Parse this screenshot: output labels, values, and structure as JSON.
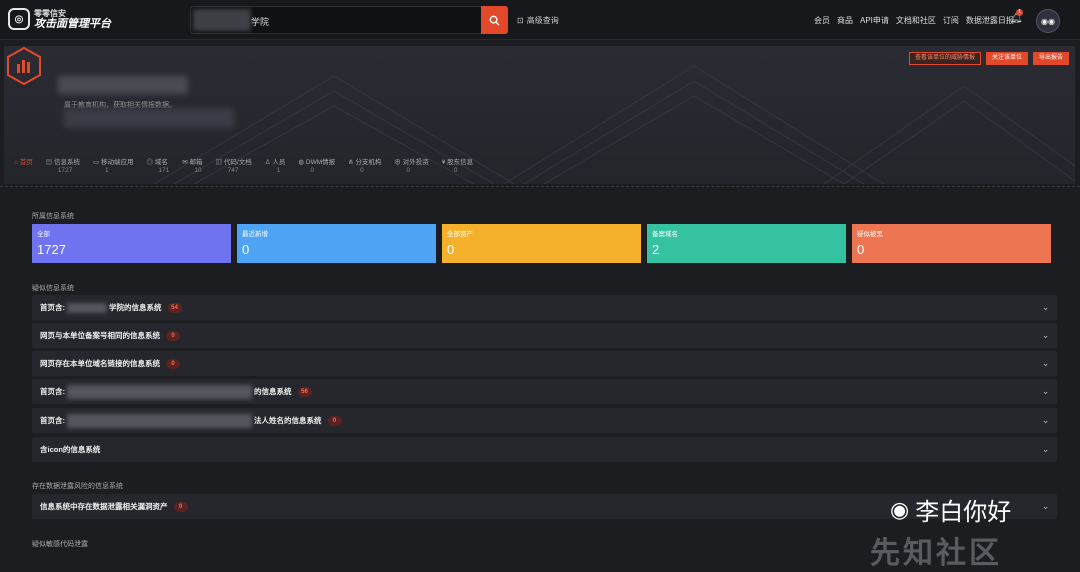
{
  "header": {
    "logo_top": "零零信安",
    "logo_main": "攻击面管理平台",
    "search_value": "学院",
    "advanced_search": "高级查询",
    "nav": [
      "会员",
      "商品",
      "API申请",
      "文档和社区",
      "订阅",
      "数据泄露日报"
    ],
    "notif_count": "1"
  },
  "banner": {
    "buttons": [
      "查看该单位的威胁情报",
      "关注该单位",
      "导出报告"
    ],
    "org_sub": "属于教育机构，获取相关情报数据。",
    "tabs": [
      {
        "label": "首页",
        "count": ""
      },
      {
        "label": "信息系统",
        "count": "1727"
      },
      {
        "label": "移动端应用",
        "count": "1"
      },
      {
        "label": "域名",
        "count": "171"
      },
      {
        "label": "邮箱",
        "count": "10"
      },
      {
        "label": "代码/文档",
        "count": "747"
      },
      {
        "label": "人员",
        "count": "1"
      },
      {
        "label": "DWM情报",
        "count": "0"
      },
      {
        "label": "分支机构",
        "count": "0"
      },
      {
        "label": "对外投资",
        "count": "0"
      },
      {
        "label": "股东信息",
        "count": "0"
      }
    ]
  },
  "sections": {
    "systems_label": "所属信息系统",
    "suspect_label": "疑似信息系统",
    "leak_label": "存在数据泄露风险的信息系统",
    "code_label": "疑似敏感代码泄露"
  },
  "cards": [
    {
      "label": "全部",
      "value": "1727",
      "color": "#6f73f0"
    },
    {
      "label": "最近新增",
      "value": "0",
      "color": "#4fa3f5"
    },
    {
      "label": "全部资产",
      "value": "0",
      "color": "#f6b12c"
    },
    {
      "label": "备案域名",
      "value": "2",
      "color": "#35c2a0"
    },
    {
      "label": "疑似被黑",
      "value": "0",
      "color": "#ee7551"
    }
  ],
  "accordions": [
    {
      "title": "首页含:",
      "suffix": "学院的信息系统",
      "badge": "54"
    },
    {
      "title": "网页与本单位备案号相同的信息系统",
      "suffix": "",
      "badge": "0"
    },
    {
      "title": "网页存在本单位域名链接的信息系统",
      "suffix": "",
      "badge": "0"
    },
    {
      "title": "首页含:",
      "suffix": "的信息系统",
      "badge": "56"
    },
    {
      "title": "首页含:",
      "suffix": "法人姓名的信息系统",
      "badge": "0"
    },
    {
      "title": "含icon的信息系统",
      "suffix": "",
      "badge": ""
    }
  ],
  "leak_row": {
    "title": "信息系统中存在数据泄露相关漏洞资产",
    "badge": "0"
  },
  "watermark": {
    "text": "李白你好",
    "brand": "先知社区"
  }
}
